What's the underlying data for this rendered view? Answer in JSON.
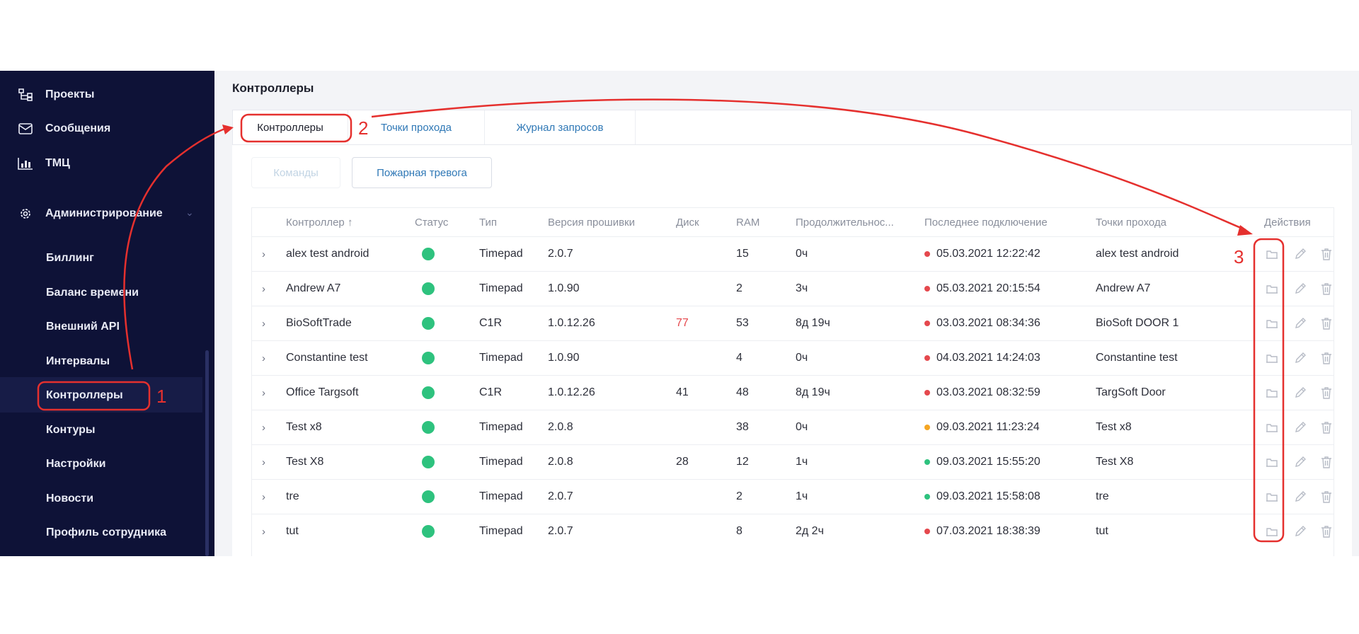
{
  "sidebar": {
    "top_items": [
      {
        "label": "Проекты",
        "icon": "project-tree-icon"
      },
      {
        "label": "Сообщения",
        "icon": "mail-icon"
      },
      {
        "label": "ТМЦ",
        "icon": "inventory-chart-icon"
      },
      {
        "label": "Администрирование",
        "icon": "gear-icon"
      }
    ],
    "sub_items": [
      "Биллинг",
      "Баланс времени",
      "Внешний API",
      "Интервалы",
      "Контроллеры",
      "Контуры",
      "Настройки",
      "Новости",
      "Профиль сотрудника"
    ],
    "active": "Контроллеры"
  },
  "page": {
    "title": "Контроллеры"
  },
  "tabs": [
    "Контроллеры",
    "Точки прохода",
    "Журнал запросов"
  ],
  "buttons": {
    "commands": "Команды",
    "fire_alarm": "Пожарная тревога"
  },
  "table": {
    "headers": [
      "Контроллер ↑",
      "Статус",
      "Тип",
      "Версия прошивки",
      "Диск",
      "RAM",
      "Продолжительнос...",
      "Последнее подключение",
      "Точки прохода",
      "Действия"
    ],
    "rows": [
      {
        "name": "alex test android",
        "type": "Timepad",
        "fw": "2.0.7",
        "disk": "",
        "disk_alert": false,
        "ram": "15",
        "dur": "0ч",
        "last": "05.03.2021 12:22:42",
        "last_color": "#e5484d",
        "points": "alex test android"
      },
      {
        "name": "Andrew A7",
        "type": "Timepad",
        "fw": "1.0.90",
        "disk": "",
        "disk_alert": false,
        "ram": "2",
        "dur": "3ч",
        "last": "05.03.2021 20:15:54",
        "last_color": "#e5484d",
        "points": "Andrew A7"
      },
      {
        "name": "BioSoftTrade",
        "type": "C1R",
        "fw": "1.0.12.26",
        "disk": "77",
        "disk_alert": true,
        "ram": "53",
        "dur": "8д 19ч",
        "last": "03.03.2021 08:34:36",
        "last_color": "#e5484d",
        "points": "BioSoft DOOR 1"
      },
      {
        "name": "Constantine test",
        "type": "Timepad",
        "fw": "1.0.90",
        "disk": "",
        "disk_alert": false,
        "ram": "4",
        "dur": "0ч",
        "last": "04.03.2021 14:24:03",
        "last_color": "#e5484d",
        "points": "Constantine test"
      },
      {
        "name": "Office Targsoft",
        "type": "C1R",
        "fw": "1.0.12.26",
        "disk": "41",
        "disk_alert": false,
        "ram": "48",
        "dur": "8д 19ч",
        "last": "03.03.2021 08:32:59",
        "last_color": "#e5484d",
        "points": "TargSoft Door"
      },
      {
        "name": "Test x8",
        "type": "Timepad",
        "fw": "2.0.8",
        "disk": "",
        "disk_alert": false,
        "ram": "38",
        "dur": "0ч",
        "last": "09.03.2021 11:23:24",
        "last_color": "#f5a623",
        "points": "Test x8"
      },
      {
        "name": "Test X8",
        "type": "Timepad",
        "fw": "2.0.8",
        "disk": "28",
        "disk_alert": false,
        "ram": "12",
        "dur": "1ч",
        "last": "09.03.2021 15:55:20",
        "last_color": "#2ec27e",
        "points": "Test X8"
      },
      {
        "name": "tre",
        "type": "Timepad",
        "fw": "2.0.7",
        "disk": "",
        "disk_alert": false,
        "ram": "2",
        "dur": "1ч",
        "last": "09.03.2021 15:58:08",
        "last_color": "#2ec27e",
        "points": "tre"
      },
      {
        "name": "tut",
        "type": "Timepad",
        "fw": "2.0.7",
        "disk": "",
        "disk_alert": false,
        "ram": "8",
        "dur": "2д 2ч",
        "last": "07.03.2021 18:38:39",
        "last_color": "#e5484d",
        "points": "tut"
      }
    ],
    "status_color": "#2ec27e",
    "action_icons": [
      "points-icon",
      "pencil-icon",
      "trash-icon"
    ]
  },
  "annotations": {
    "labels": [
      "1",
      "2",
      "3"
    ],
    "color": "#e5302e"
  }
}
